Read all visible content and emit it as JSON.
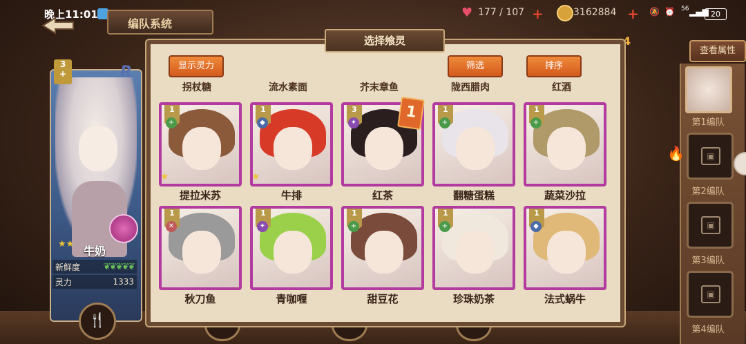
{
  "status_bar": {
    "time": "晚上11:01",
    "net_speed": "56",
    "battery": "20"
  },
  "hud": {
    "screen_title": "编队系统",
    "stamina": "177 / 107",
    "coins": "3162884",
    "view_attributes": "查看属性",
    "badge_number": "4"
  },
  "modal": {
    "title": "选择飨灵",
    "show_power_button": "显示灵力",
    "filter_button": "筛选",
    "sort_button": "排序",
    "top_row_names": [
      "拐杖糖",
      "流水素面",
      "芥末章鱼",
      "陇西腊肉",
      "红酒"
    ],
    "cards": [
      {
        "name": "提拉米苏",
        "level": "1",
        "element": "+",
        "element_color": "#4a9a4a",
        "hair": "#8a5a3a",
        "star": true
      },
      {
        "name": "牛排",
        "level": "1",
        "element": "◆",
        "element_color": "#4a6aa8",
        "hair": "#d83a28",
        "star": true
      },
      {
        "name": "红茶",
        "level": "3",
        "element": "✦",
        "element_color": "#8a4ab0",
        "hair": "#2a1e1e",
        "star": false,
        "rank": "1"
      },
      {
        "name": "翻糖蛋糕",
        "level": "1",
        "element": "+",
        "element_color": "#4a9a4a",
        "hair": "#e8e4ea",
        "star": false
      },
      {
        "name": "蔬菜沙拉",
        "level": "1",
        "element": "+",
        "element_color": "#4a9a4a",
        "hair": "#b09a6a",
        "star": false
      },
      {
        "name": "秋刀鱼",
        "level": "1",
        "element": "✕",
        "element_color": "#c05a5a",
        "hair": "#9a9a9a",
        "star": false
      },
      {
        "name": "青咖喱",
        "level": "1",
        "element": "✦",
        "element_color": "#8a4ab0",
        "hair": "#9ad04a",
        "star": false
      },
      {
        "name": "甜豆花",
        "level": "1",
        "element": "+",
        "element_color": "#4a9a4a",
        "hair": "#7a4a3a",
        "star": false
      },
      {
        "name": "珍珠奶茶",
        "level": "1",
        "element": "+",
        "element_color": "#4a9a4a",
        "hair": "#f0e8dc",
        "star": false
      },
      {
        "name": "法式蜗牛",
        "level": "1",
        "element": "◆",
        "element_color": "#4a6aa8",
        "hair": "#e0b878",
        "star": false
      }
    ]
  },
  "character": {
    "level": "3",
    "element": "+",
    "rarity": "R",
    "name": "牛奶",
    "freshness_label": "新鲜度",
    "power_label": "灵力",
    "power_value": "1333"
  },
  "squads": {
    "labels": [
      "第1编队",
      "第2编队",
      "第3编队",
      "第4编队"
    ]
  },
  "colors": {
    "accent": "#e06a2a",
    "card_border": "#b23aa0",
    "modal_bg": "#e9dcc3"
  }
}
